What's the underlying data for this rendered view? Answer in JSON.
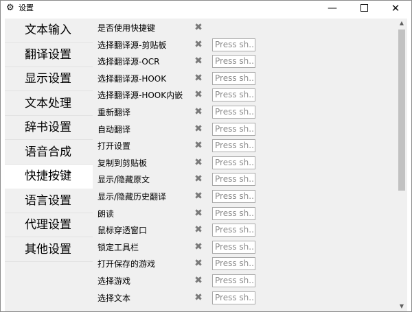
{
  "window": {
    "title": "设置",
    "icon": "gear-icon",
    "minimize_glyph": "—",
    "close_glyph": "✕"
  },
  "sidebar": {
    "items": [
      {
        "label": "文本输入",
        "active": false
      },
      {
        "label": "翻译设置",
        "active": false
      },
      {
        "label": "显示设置",
        "active": false
      },
      {
        "label": "文本处理",
        "active": false
      },
      {
        "label": "辞书设置",
        "active": false
      },
      {
        "label": "语音合成",
        "active": false
      },
      {
        "label": "快捷按键",
        "active": true
      },
      {
        "label": "语言设置",
        "active": false
      },
      {
        "label": "代理设置",
        "active": false
      },
      {
        "label": "其他设置",
        "active": false
      }
    ]
  },
  "hotkeys": {
    "clear_glyph": "✖",
    "placeholder": "Press sh...",
    "rows": [
      {
        "label": "是否使用快捷键",
        "has_input": false
      },
      {
        "label": "选择翻译源-剪贴板",
        "has_input": true
      },
      {
        "label": "选择翻译源-OCR",
        "has_input": true
      },
      {
        "label": "选择翻译源-HOOK",
        "has_input": true
      },
      {
        "label": "选择翻译源-HOOK内嵌",
        "has_input": true
      },
      {
        "label": "重新翻译",
        "has_input": true
      },
      {
        "label": "自动翻译",
        "has_input": true
      },
      {
        "label": "打开设置",
        "has_input": true
      },
      {
        "label": "复制到剪贴板",
        "has_input": true
      },
      {
        "label": "显示/隐藏原文",
        "has_input": true
      },
      {
        "label": "显示/隐藏历史翻译",
        "has_input": true
      },
      {
        "label": "朗读",
        "has_input": true
      },
      {
        "label": "鼠标穿透窗口",
        "has_input": true
      },
      {
        "label": "锁定工具栏",
        "has_input": true
      },
      {
        "label": "打开保存的游戏",
        "has_input": true
      },
      {
        "label": "选择游戏",
        "has_input": true
      },
      {
        "label": "选择文本",
        "has_input": true
      }
    ]
  },
  "scrollbar": {
    "up_glyph": "▲",
    "down_glyph": "▼",
    "position": 0.0
  }
}
